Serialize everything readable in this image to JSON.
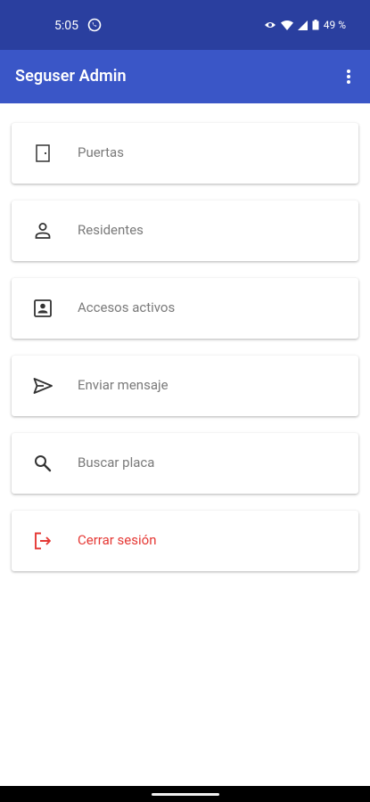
{
  "status_bar": {
    "time": "5:05",
    "battery": "49 %",
    "bg": "#2a3f9f",
    "icons": [
      "whatsapp-icon",
      "eye-icon",
      "wifi-icon",
      "signal-icon",
      "battery-icon"
    ]
  },
  "app_bar": {
    "title": "Seguser Admin",
    "bg": "#3a56c7",
    "menu_icon": "more-vert-icon"
  },
  "menu": {
    "items": [
      {
        "label": "Puertas",
        "icon": "door-icon"
      },
      {
        "label": "Residentes",
        "icon": "person-icon"
      },
      {
        "label": "Accesos activos",
        "icon": "contact-card-icon"
      },
      {
        "label": "Enviar mensaje",
        "icon": "send-icon"
      },
      {
        "label": "Buscar placa",
        "icon": "search-icon"
      },
      {
        "label": "Cerrar sesión",
        "icon": "logout-icon",
        "color": "#e53935"
      }
    ]
  }
}
